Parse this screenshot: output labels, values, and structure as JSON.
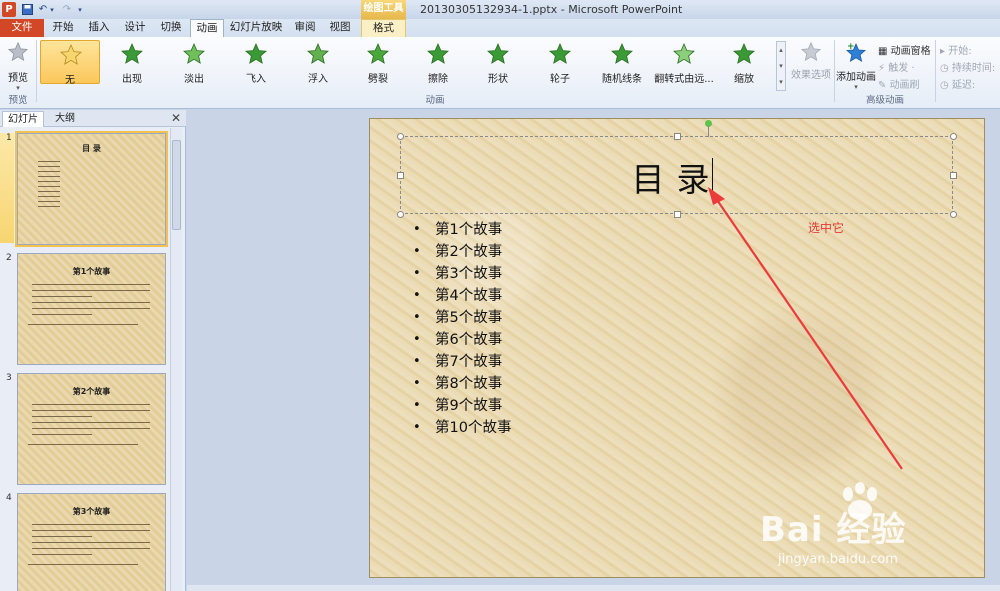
{
  "titlebar": {
    "app_icon_glyph": "P",
    "context_group": "绘图工具",
    "window_title": "20130305132934-1.pptx - Microsoft PowerPoint"
  },
  "tabs": [
    {
      "label": "文件",
      "kind": "file"
    },
    {
      "label": "开始",
      "kind": "normal"
    },
    {
      "label": "插入",
      "kind": "normal"
    },
    {
      "label": "设计",
      "kind": "normal"
    },
    {
      "label": "切换",
      "kind": "normal"
    },
    {
      "label": "动画",
      "kind": "active"
    },
    {
      "label": "幻灯片放映",
      "kind": "normal"
    },
    {
      "label": "审阅",
      "kind": "normal"
    },
    {
      "label": "视图",
      "kind": "normal"
    },
    {
      "label": "格式",
      "kind": "ctx"
    }
  ],
  "ribbon": {
    "preview_label": "预览",
    "preview_group": "预览",
    "animation_group": "动画",
    "advanced_group": "高级动画",
    "effect_options": "效果选项",
    "add_animation": "添加动画",
    "animation_pane": "动画窗格",
    "trigger": "触发 ·",
    "animation_painter": "动画刷",
    "start": "开始:",
    "duration": "持续时间:",
    "delay": "延迟:",
    "gallery": [
      {
        "label": "无",
        "selected": true,
        "icon": "star-none-icon"
      },
      {
        "label": "出现",
        "selected": false,
        "icon": "star-appear-icon"
      },
      {
        "label": "淡出",
        "selected": false,
        "icon": "star-fade-icon"
      },
      {
        "label": "飞入",
        "selected": false,
        "icon": "star-fly-in-icon"
      },
      {
        "label": "浮入",
        "selected": false,
        "icon": "star-float-in-icon"
      },
      {
        "label": "劈裂",
        "selected": false,
        "icon": "star-split-icon"
      },
      {
        "label": "擦除",
        "selected": false,
        "icon": "star-wipe-icon"
      },
      {
        "label": "形状",
        "selected": false,
        "icon": "star-shape-icon"
      },
      {
        "label": "轮子",
        "selected": false,
        "icon": "star-wheel-icon"
      },
      {
        "label": "随机线条",
        "selected": false,
        "icon": "star-random-bars-icon"
      },
      {
        "label": "翻转式由远...",
        "selected": false,
        "icon": "star-grow-turn-icon"
      },
      {
        "label": "缩放",
        "selected": false,
        "icon": "star-zoom-icon"
      }
    ]
  },
  "pane": {
    "tab_slides": "幻灯片",
    "tab_outline": "大纲",
    "close": "✕",
    "thumbnails": [
      {
        "num": "1",
        "title": "目  录"
      },
      {
        "num": "2",
        "title": "第1个故事"
      },
      {
        "num": "3",
        "title": "第2个故事"
      },
      {
        "num": "4",
        "title": "第3个故事"
      }
    ]
  },
  "slide": {
    "title": "目录",
    "bullets": [
      "第1个故事",
      "第2个故事",
      "第3个故事",
      "第4个故事",
      "第5个故事",
      "第6个故事",
      "第7个故事",
      "第8个故事",
      "第9个故事",
      "第10个故事"
    ],
    "annotation": "选中它"
  },
  "watermark": {
    "text": "Bai 经验",
    "url": "jingyan.baidu.com"
  },
  "colors": {
    "accent_file_tab": "#d24726",
    "star_green": "#4aa83a",
    "annotation_red": "#e53935"
  }
}
